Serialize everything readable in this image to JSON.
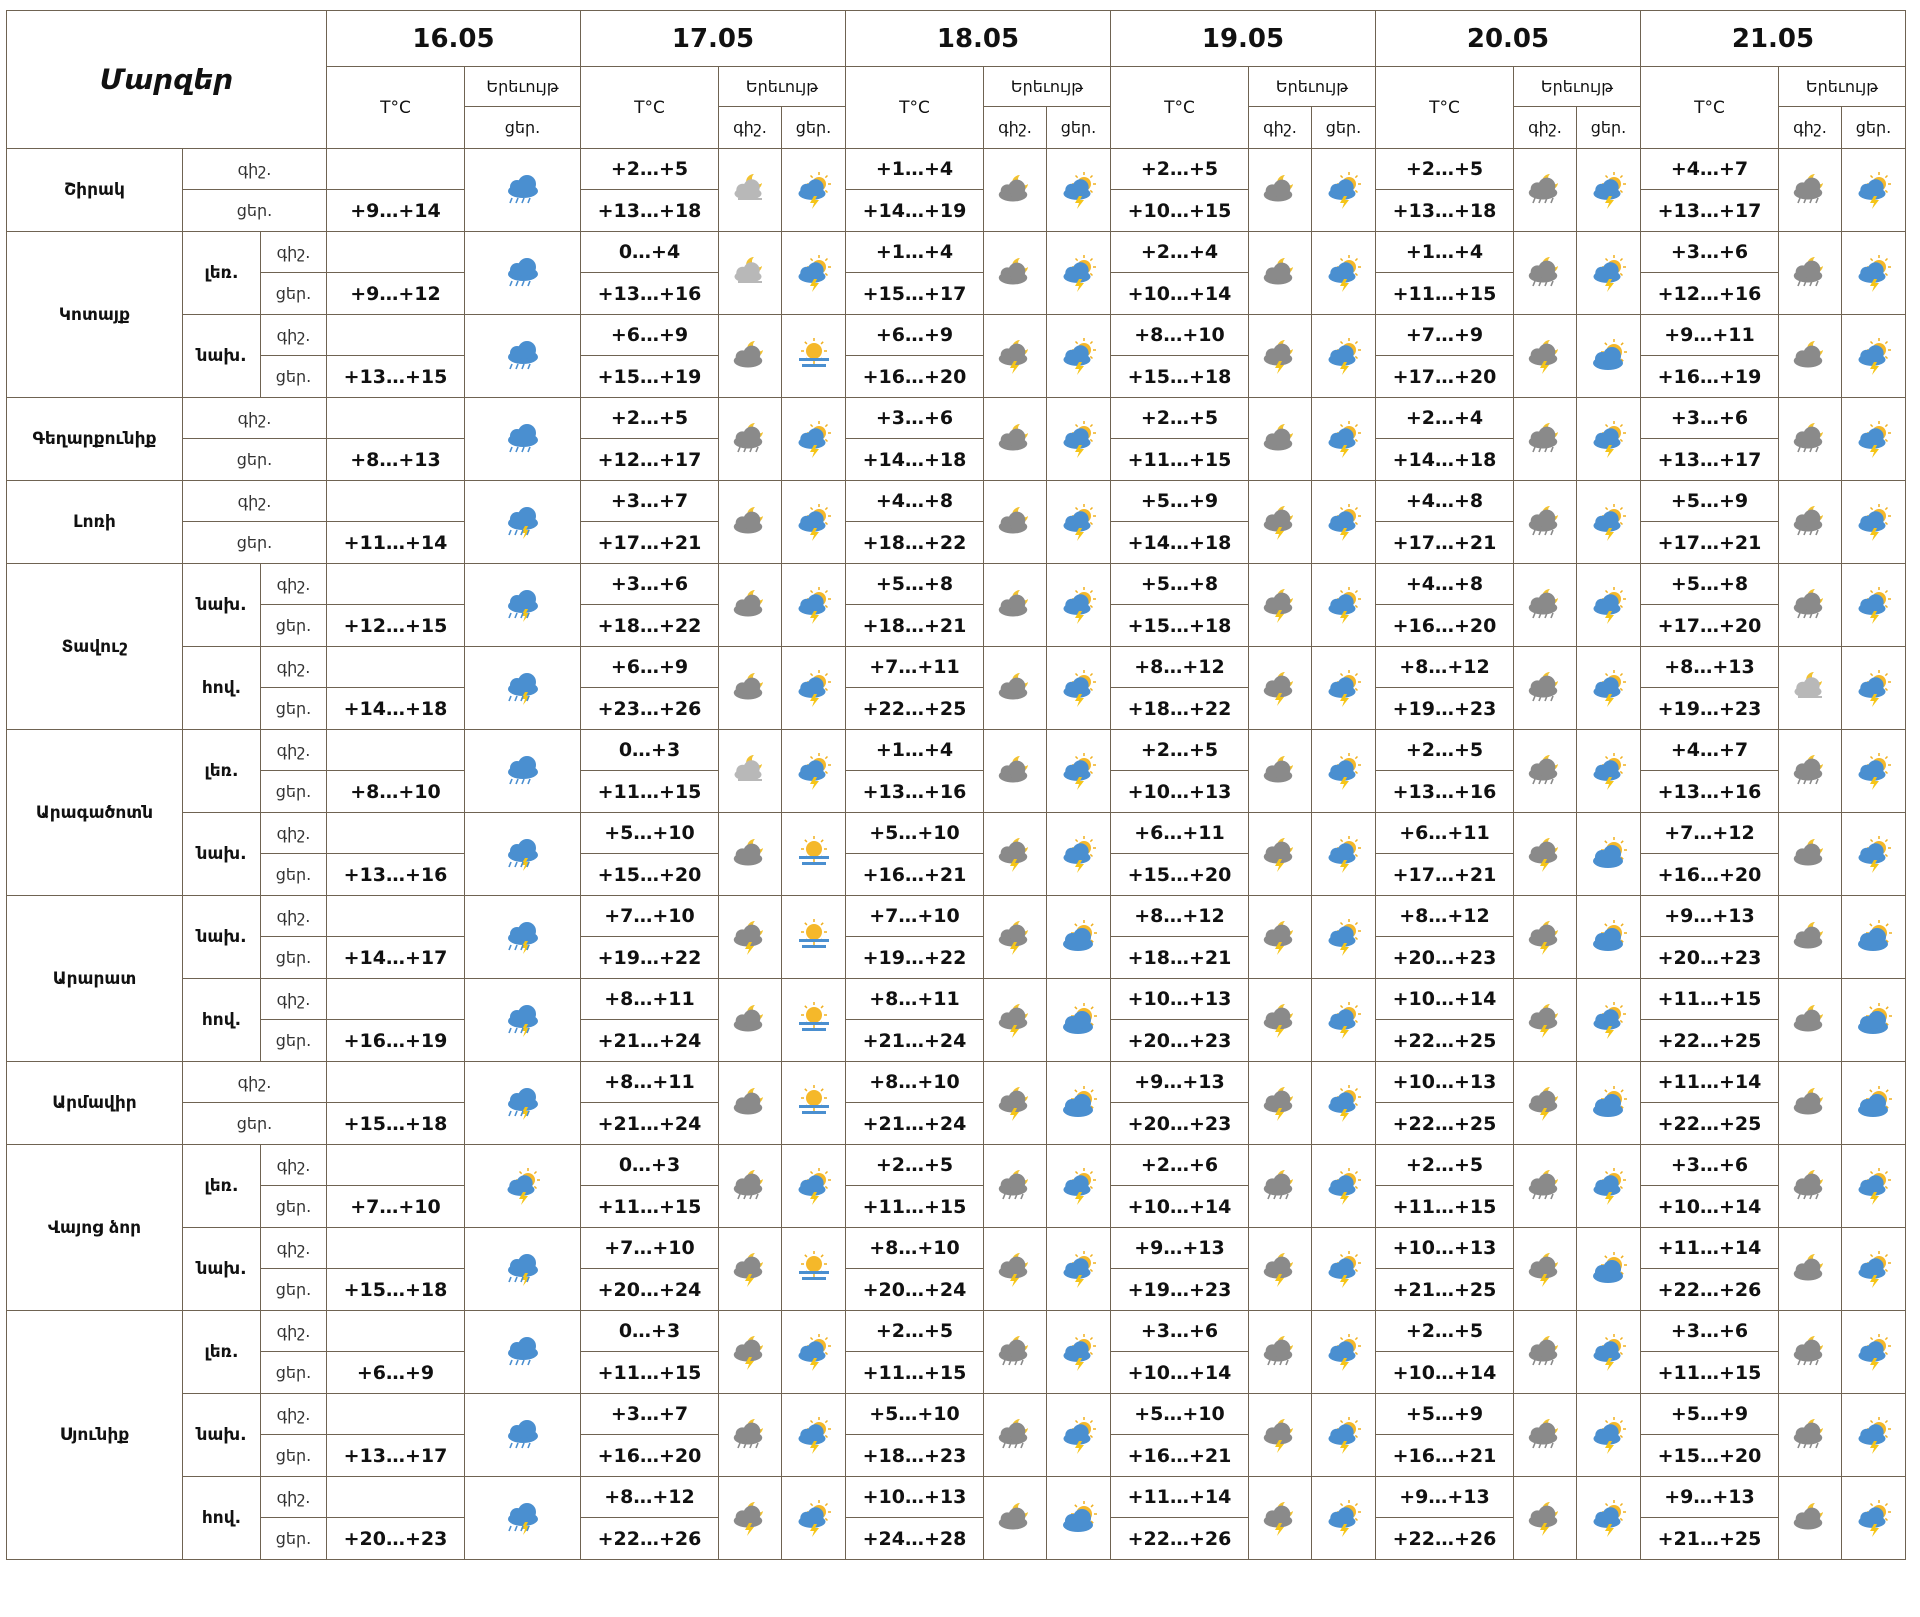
{
  "header": {
    "title": "Մարզեր",
    "dates": [
      "16.05",
      "17.05",
      "18.05",
      "19.05",
      "20.05",
      "21.05"
    ],
    "temp_label": "T°C",
    "phen_label": "Երեւույթ",
    "night_label": "գիշ.",
    "day_label": "ցեր."
  },
  "regions": [
    {
      "name": "Շիրակ",
      "sub": "",
      "d16": "+9…+14",
      "i16": "cloud-rain-icon",
      "days": [
        {
          "n": "+2…+5",
          "d": "+13…+18",
          "ni": "fog-moon-icon",
          "di": "sun-cloud-rain-icon"
        },
        {
          "n": "+1…+4",
          "d": "+14…+19",
          "ni": "moon-cloud-icon",
          "di": "sun-cloud-rain-icon"
        },
        {
          "n": "+2…+5",
          "d": "+10…+15",
          "ni": "moon-cloud-icon",
          "di": "sun-cloud-rain-icon"
        },
        {
          "n": "+2…+5",
          "d": "+13…+18",
          "ni": "moon-cloud-rain-icon",
          "di": "sun-cloud-rain-icon"
        },
        {
          "n": "+4…+7",
          "d": "+13…+17",
          "ni": "moon-cloud-rain-icon",
          "di": "sun-cloud-rain-icon"
        }
      ]
    },
    {
      "name": "Կոտայք",
      "sub": "լեռ.",
      "d16": "+9…+12",
      "i16": "cloud-rain-icon",
      "days": [
        {
          "n": "0…+4",
          "d": "+13…+16",
          "ni": "fog-moon-icon",
          "di": "sun-cloud-rain-icon"
        },
        {
          "n": "+1…+4",
          "d": "+15…+17",
          "ni": "moon-cloud-icon",
          "di": "sun-cloud-rain-icon"
        },
        {
          "n": "+2…+4",
          "d": "+10…+14",
          "ni": "moon-cloud-icon",
          "di": "sun-cloud-rain-icon"
        },
        {
          "n": "+1…+4",
          "d": "+11…+15",
          "ni": "moon-cloud-rain-icon",
          "di": "sun-cloud-rain-icon"
        },
        {
          "n": "+3…+6",
          "d": "+12…+16",
          "ni": "moon-cloud-rain-icon",
          "di": "sun-cloud-rain-icon"
        }
      ]
    },
    {
      "name": "",
      "sub": "նախ.",
      "d16": "+13…+15",
      "i16": "cloud-rain-icon",
      "days": [
        {
          "n": "+6…+9",
          "d": "+15…+19",
          "ni": "moon-cloud-icon",
          "di": "sun-haze-icon"
        },
        {
          "n": "+6…+9",
          "d": "+16…+20",
          "ni": "moon-cloud-storm-icon",
          "di": "sun-cloud-rain-icon"
        },
        {
          "n": "+8…+10",
          "d": "+15…+18",
          "ni": "moon-cloud-storm-icon",
          "di": "sun-cloud-rain-icon"
        },
        {
          "n": "+7…+9",
          "d": "+17…+20",
          "ni": "moon-cloud-storm-icon",
          "di": "sun-cloud-icon"
        },
        {
          "n": "+9…+11",
          "d": "+16…+19",
          "ni": "moon-cloud-icon",
          "di": "sun-cloud-rain-icon"
        }
      ]
    },
    {
      "name": "Գեղարքունիք",
      "sub": "",
      "d16": "+8…+13",
      "i16": "cloud-rain-icon",
      "days": [
        {
          "n": "+2…+5",
          "d": "+12…+17",
          "ni": "moon-cloud-rain-icon",
          "di": "sun-cloud-rain-icon"
        },
        {
          "n": "+3…+6",
          "d": "+14…+18",
          "ni": "moon-cloud-icon",
          "di": "sun-cloud-rain-icon"
        },
        {
          "n": "+2…+5",
          "d": "+11…+15",
          "ni": "moon-cloud-icon",
          "di": "sun-cloud-rain-icon"
        },
        {
          "n": "+2…+4",
          "d": "+14…+18",
          "ni": "moon-cloud-rain-icon",
          "di": "sun-cloud-rain-icon"
        },
        {
          "n": "+3…+6",
          "d": "+13…+17",
          "ni": "moon-cloud-rain-icon",
          "di": "sun-cloud-rain-icon"
        }
      ]
    },
    {
      "name": "Լոռի",
      "sub": "",
      "d16": "+11…+14",
      "i16": "cloud-storm-icon",
      "days": [
        {
          "n": "+3…+7",
          "d": "+17…+21",
          "ni": "moon-cloud-icon",
          "di": "sun-cloud-rain-icon"
        },
        {
          "n": "+4…+8",
          "d": "+18…+22",
          "ni": "moon-cloud-icon",
          "di": "sun-cloud-rain-icon"
        },
        {
          "n": "+5…+9",
          "d": "+14…+18",
          "ni": "moon-cloud-storm-icon",
          "di": "sun-cloud-rain-icon"
        },
        {
          "n": "+4…+8",
          "d": "+17…+21",
          "ni": "moon-cloud-rain-icon",
          "di": "sun-cloud-rain-icon"
        },
        {
          "n": "+5…+9",
          "d": "+17…+21",
          "ni": "moon-cloud-rain-icon",
          "di": "sun-cloud-rain-icon"
        }
      ]
    },
    {
      "name": "Տավուշ",
      "sub": "նախ.",
      "d16": "+12…+15",
      "i16": "cloud-storm-icon",
      "days": [
        {
          "n": "+3…+6",
          "d": "+18…+22",
          "ni": "moon-cloud-icon",
          "di": "sun-cloud-rain-icon"
        },
        {
          "n": "+5…+8",
          "d": "+18…+21",
          "ni": "moon-cloud-icon",
          "di": "sun-cloud-rain-icon"
        },
        {
          "n": "+5…+8",
          "d": "+15…+18",
          "ni": "moon-cloud-storm-icon",
          "di": "sun-cloud-rain-icon"
        },
        {
          "n": "+4…+8",
          "d": "+16…+20",
          "ni": "moon-cloud-rain-icon",
          "di": "sun-cloud-rain-icon"
        },
        {
          "n": "+5…+8",
          "d": "+17…+20",
          "ni": "moon-cloud-rain-icon",
          "di": "sun-cloud-rain-icon"
        }
      ]
    },
    {
      "name": "",
      "sub": "հով.",
      "d16": "+14…+18",
      "i16": "cloud-storm-icon",
      "days": [
        {
          "n": "+6…+9",
          "d": "+23…+26",
          "ni": "moon-cloud-icon",
          "di": "sun-cloud-rain-icon"
        },
        {
          "n": "+7…+11",
          "d": "+22…+25",
          "ni": "moon-cloud-icon",
          "di": "sun-cloud-rain-icon"
        },
        {
          "n": "+8…+12",
          "d": "+18…+22",
          "ni": "moon-cloud-storm-icon",
          "di": "sun-cloud-rain-icon"
        },
        {
          "n": "+8…+12",
          "d": "+19…+23",
          "ni": "moon-cloud-rain-icon",
          "di": "sun-cloud-rain-icon"
        },
        {
          "n": "+8…+13",
          "d": "+19…+23",
          "ni": "fog-moon-icon",
          "di": "sun-cloud-rain-icon"
        }
      ]
    },
    {
      "name": "Արագածոտն",
      "sub": "լեռ.",
      "d16": "+8…+10",
      "i16": "cloud-rain-icon",
      "days": [
        {
          "n": "0…+3",
          "d": "+11…+15",
          "ni": "fog-moon-icon",
          "di": "sun-cloud-rain-icon"
        },
        {
          "n": "+1…+4",
          "d": "+13…+16",
          "ni": "moon-cloud-icon",
          "di": "sun-cloud-rain-icon"
        },
        {
          "n": "+2…+5",
          "d": "+10…+13",
          "ni": "moon-cloud-icon",
          "di": "sun-cloud-rain-icon"
        },
        {
          "n": "+2…+5",
          "d": "+13…+16",
          "ni": "moon-cloud-rain-icon",
          "di": "sun-cloud-rain-icon"
        },
        {
          "n": "+4…+7",
          "d": "+13…+16",
          "ni": "moon-cloud-rain-icon",
          "di": "sun-cloud-rain-icon"
        }
      ]
    },
    {
      "name": "",
      "sub": "նախ.",
      "d16": "+13…+16",
      "i16": "cloud-storm-icon",
      "days": [
        {
          "n": "+5…+10",
          "d": "+15…+20",
          "ni": "moon-cloud-icon",
          "di": "sun-haze-icon"
        },
        {
          "n": "+5…+10",
          "d": "+16…+21",
          "ni": "moon-cloud-storm-icon",
          "di": "sun-cloud-rain-icon"
        },
        {
          "n": "+6…+11",
          "d": "+15…+20",
          "ni": "moon-cloud-storm-icon",
          "di": "sun-cloud-rain-icon"
        },
        {
          "n": "+6…+11",
          "d": "+17…+21",
          "ni": "moon-cloud-storm-icon",
          "di": "sun-cloud-icon"
        },
        {
          "n": "+7…+12",
          "d": "+16…+20",
          "ni": "moon-cloud-icon",
          "di": "sun-cloud-rain-icon"
        }
      ]
    },
    {
      "name": "Արարատ",
      "sub": "նախ.",
      "d16": "+14…+17",
      "i16": "cloud-storm-icon",
      "days": [
        {
          "n": "+7…+10",
          "d": "+19…+22",
          "ni": "moon-cloud-storm-icon",
          "di": "sun-haze-icon"
        },
        {
          "n": "+7…+10",
          "d": "+19…+22",
          "ni": "moon-cloud-storm-icon",
          "di": "sun-cloud-icon"
        },
        {
          "n": "+8…+12",
          "d": "+18…+21",
          "ni": "moon-cloud-storm-icon",
          "di": "sun-cloud-rain-icon"
        },
        {
          "n": "+8…+12",
          "d": "+20…+23",
          "ni": "moon-cloud-storm-icon",
          "di": "sun-cloud-icon"
        },
        {
          "n": "+9…+13",
          "d": "+20…+23",
          "ni": "moon-cloud-icon",
          "di": "sun-cloud-icon"
        }
      ]
    },
    {
      "name": "",
      "sub": "հով.",
      "d16": "+16…+19",
      "i16": "cloud-storm-icon",
      "days": [
        {
          "n": "+8…+11",
          "d": "+21…+24",
          "ni": "moon-cloud-icon",
          "di": "sun-haze-icon"
        },
        {
          "n": "+8…+11",
          "d": "+21…+24",
          "ni": "moon-cloud-storm-icon",
          "di": "sun-cloud-icon"
        },
        {
          "n": "+10…+13",
          "d": "+20…+23",
          "ni": "moon-cloud-storm-icon",
          "di": "sun-cloud-rain-icon"
        },
        {
          "n": "+10…+14",
          "d": "+22…+25",
          "ni": "moon-cloud-storm-icon",
          "di": "sun-cloud-rain-icon"
        },
        {
          "n": "+11…+15",
          "d": "+22…+25",
          "ni": "moon-cloud-icon",
          "di": "sun-cloud-icon"
        }
      ]
    },
    {
      "name": "Արմավիր",
      "sub": "",
      "d16": "+15…+18",
      "i16": "cloud-storm-icon",
      "days": [
        {
          "n": "+8…+11",
          "d": "+21…+24",
          "ni": "moon-cloud-icon",
          "di": "sun-haze-icon"
        },
        {
          "n": "+8…+10",
          "d": "+21…+24",
          "ni": "moon-cloud-storm-icon",
          "di": "sun-cloud-icon"
        },
        {
          "n": "+9…+13",
          "d": "+20…+23",
          "ni": "moon-cloud-storm-icon",
          "di": "sun-cloud-rain-icon"
        },
        {
          "n": "+10…+13",
          "d": "+22…+25",
          "ni": "moon-cloud-storm-icon",
          "di": "sun-cloud-icon"
        },
        {
          "n": "+11…+14",
          "d": "+22…+25",
          "ni": "moon-cloud-icon",
          "di": "sun-cloud-icon"
        }
      ]
    },
    {
      "name": "Վայոց ձոր",
      "sub": "լեռ.",
      "d16": "+7…+10",
      "i16": "sun-cloud-rain-icon",
      "days": [
        {
          "n": "0…+3",
          "d": "+11…+15",
          "ni": "moon-cloud-rain-icon",
          "di": "sun-cloud-rain-icon"
        },
        {
          "n": "+2…+5",
          "d": "+11…+15",
          "ni": "moon-cloud-rain-icon",
          "di": "sun-cloud-rain-icon"
        },
        {
          "n": "+2…+6",
          "d": "+10…+14",
          "ni": "moon-cloud-rain-icon",
          "di": "sun-cloud-rain-icon"
        },
        {
          "n": "+2…+5",
          "d": "+11…+15",
          "ni": "moon-cloud-rain-icon",
          "di": "sun-cloud-rain-icon"
        },
        {
          "n": "+3…+6",
          "d": "+10…+14",
          "ni": "moon-cloud-rain-icon",
          "di": "sun-cloud-rain-icon"
        }
      ]
    },
    {
      "name": "",
      "sub": "նախ.",
      "d16": "+15…+18",
      "i16": "cloud-storm-icon",
      "days": [
        {
          "n": "+7…+10",
          "d": "+20…+24",
          "ni": "moon-cloud-storm-icon",
          "di": "sun-haze-icon"
        },
        {
          "n": "+8…+10",
          "d": "+20…+24",
          "ni": "moon-cloud-storm-icon",
          "di": "sun-cloud-rain-icon"
        },
        {
          "n": "+9…+13",
          "d": "+19…+23",
          "ni": "moon-cloud-storm-icon",
          "di": "sun-cloud-rain-icon"
        },
        {
          "n": "+10…+13",
          "d": "+21…+25",
          "ni": "moon-cloud-storm-icon",
          "di": "sun-cloud-icon"
        },
        {
          "n": "+11…+14",
          "d": "+22…+26",
          "ni": "moon-cloud-icon",
          "di": "sun-cloud-rain-icon"
        }
      ]
    },
    {
      "name": "Սյունիք",
      "sub": "լեռ.",
      "d16": "+6…+9",
      "i16": "cloud-rain-icon",
      "days": [
        {
          "n": "0…+3",
          "d": "+11…+15",
          "ni": "moon-cloud-storm-icon",
          "di": "sun-cloud-rain-icon"
        },
        {
          "n": "+2…+5",
          "d": "+11…+15",
          "ni": "moon-cloud-rain-icon",
          "di": "sun-cloud-rain-icon"
        },
        {
          "n": "+3…+6",
          "d": "+10…+14",
          "ni": "moon-cloud-rain-icon",
          "di": "sun-cloud-rain-icon"
        },
        {
          "n": "+2…+5",
          "d": "+10…+14",
          "ni": "moon-cloud-rain-icon",
          "di": "sun-cloud-rain-icon"
        },
        {
          "n": "+3…+6",
          "d": "+11…+15",
          "ni": "moon-cloud-rain-icon",
          "di": "sun-cloud-rain-icon"
        }
      ]
    },
    {
      "name": "",
      "sub": "նախ.",
      "d16": "+13…+17",
      "i16": "cloud-rain-icon",
      "days": [
        {
          "n": "+3…+7",
          "d": "+16…+20",
          "ni": "moon-cloud-rain-icon",
          "di": "sun-cloud-rain-icon"
        },
        {
          "n": "+5…+10",
          "d": "+18…+23",
          "ni": "moon-cloud-rain-icon",
          "di": "sun-cloud-rain-icon"
        },
        {
          "n": "+5…+10",
          "d": "+16…+21",
          "ni": "moon-cloud-storm-icon",
          "di": "sun-cloud-rain-icon"
        },
        {
          "n": "+5…+9",
          "d": "+16…+21",
          "ni": "moon-cloud-rain-icon",
          "di": "sun-cloud-rain-icon"
        },
        {
          "n": "+5…+9",
          "d": "+15…+20",
          "ni": "moon-cloud-rain-icon",
          "di": "sun-cloud-rain-icon"
        }
      ]
    },
    {
      "name": "",
      "sub": "հով.",
      "d16": "+20…+23",
      "i16": "cloud-storm-icon",
      "days": [
        {
          "n": "+8…+12",
          "d": "+22…+26",
          "ni": "moon-cloud-storm-icon",
          "di": "sun-cloud-rain-icon"
        },
        {
          "n": "+10…+13",
          "d": "+24…+28",
          "ni": "moon-cloud-icon",
          "di": "sun-cloud-icon"
        },
        {
          "n": "+11…+14",
          "d": "+22…+26",
          "ni": "moon-cloud-storm-icon",
          "di": "sun-cloud-rain-icon"
        },
        {
          "n": "+9…+13",
          "d": "+22…+26",
          "ni": "moon-cloud-storm-icon",
          "di": "sun-cloud-rain-icon"
        },
        {
          "n": "+9…+13",
          "d": "+21…+25",
          "ni": "moon-cloud-icon",
          "di": "sun-cloud-rain-icon"
        }
      ]
    }
  ]
}
